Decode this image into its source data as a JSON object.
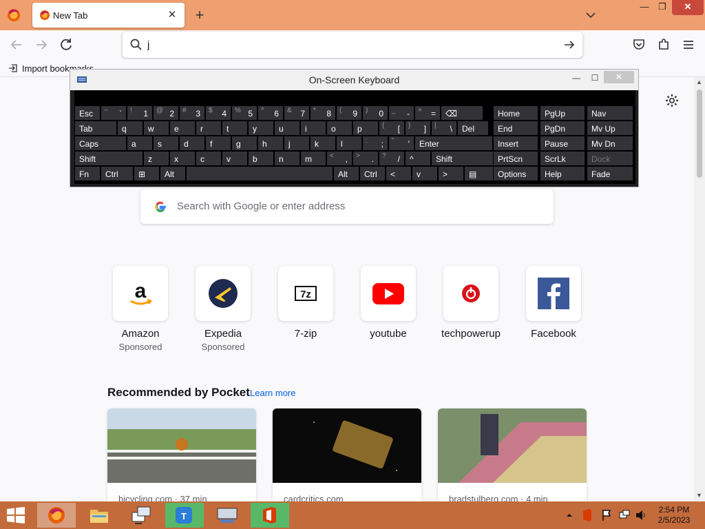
{
  "browser": {
    "tab_title": "New Tab",
    "close_tab_glyph": "✕",
    "new_tab_glyph": "+",
    "window_minimize_glyph": "—",
    "window_maximize_glyph": "❐",
    "window_close_glyph": "✕"
  },
  "urlbar": {
    "value": "j",
    "placeholder": ""
  },
  "bookmarks": [
    {
      "label": "Import bookmarks..."
    }
  ],
  "newtab": {
    "search_placeholder": "Search with Google or enter address",
    "top_sites": [
      {
        "name": "Amazon",
        "sponsored": "Sponsored",
        "icon": "amazon-icon"
      },
      {
        "name": "Expedia",
        "sponsored": "Sponsored",
        "icon": "expedia-icon"
      },
      {
        "name": "7-zip",
        "sponsored": "",
        "icon": "7zip-icon"
      },
      {
        "name": "youtube",
        "sponsored": "",
        "icon": "youtube-icon"
      },
      {
        "name": "techpowerup",
        "sponsored": "",
        "icon": "techpowerup-icon"
      },
      {
        "name": "Facebook",
        "sponsored": "",
        "icon": "facebook-icon"
      }
    ],
    "pocket_heading": "Recommended by Pocket",
    "pocket_learn_more": "Learn more",
    "pocket_cards": [
      {
        "source": "bicycling.com · 37 min"
      },
      {
        "source": "cardcritics.com"
      },
      {
        "source": "bradstulberg.com · 4 min"
      }
    ]
  },
  "osk": {
    "title": "On-Screen Keyboard",
    "rows": [
      [
        {
          "main": "Esc"
        },
        {
          "main": "`",
          "shift": "~"
        },
        {
          "main": "1",
          "shift": "!"
        },
        {
          "main": "2",
          "shift": "@"
        },
        {
          "main": "3",
          "shift": "#"
        },
        {
          "main": "4",
          "shift": "$"
        },
        {
          "main": "5",
          "shift": "%"
        },
        {
          "main": "6",
          "shift": "^"
        },
        {
          "main": "7",
          "shift": "&"
        },
        {
          "main": "8",
          "shift": "*"
        },
        {
          "main": "9",
          "shift": "("
        },
        {
          "main": "0",
          "shift": ")"
        },
        {
          "main": "-",
          "shift": "_"
        },
        {
          "main": "=",
          "shift": "+"
        },
        {
          "main": "⌫"
        }
      ],
      [
        {
          "main": "Tab"
        },
        {
          "main": "q"
        },
        {
          "main": "w"
        },
        {
          "main": "e"
        },
        {
          "main": "r"
        },
        {
          "main": "t"
        },
        {
          "main": "y"
        },
        {
          "main": "u"
        },
        {
          "main": "i"
        },
        {
          "main": "o"
        },
        {
          "main": "p"
        },
        {
          "main": "[",
          "shift": "{"
        },
        {
          "main": "]",
          "shift": "}"
        },
        {
          "main": "\\",
          "shift": "|"
        },
        {
          "main": "Del"
        }
      ],
      [
        {
          "main": "Caps"
        },
        {
          "main": "a"
        },
        {
          "main": "s"
        },
        {
          "main": "d"
        },
        {
          "main": "f"
        },
        {
          "main": "g"
        },
        {
          "main": "h"
        },
        {
          "main": "j"
        },
        {
          "main": "k"
        },
        {
          "main": "l"
        },
        {
          "main": ";",
          "shift": ":"
        },
        {
          "main": "'",
          "shift": "\""
        },
        {
          "main": "Enter"
        }
      ],
      [
        {
          "main": "Shift"
        },
        {
          "main": "z"
        },
        {
          "main": "x"
        },
        {
          "main": "c"
        },
        {
          "main": "v"
        },
        {
          "main": "b"
        },
        {
          "main": "n"
        },
        {
          "main": "m"
        },
        {
          "main": ",",
          "shift": "<"
        },
        {
          "main": ".",
          "shift": ">"
        },
        {
          "main": "/",
          "shift": "?"
        },
        {
          "main": "^"
        },
        {
          "main": "Shift"
        }
      ],
      [
        {
          "main": "Fn"
        },
        {
          "main": "Ctrl"
        },
        {
          "main": "⊞"
        },
        {
          "main": "Alt"
        },
        {
          "main": ""
        },
        {
          "main": "Alt"
        },
        {
          "main": "Ctrl"
        },
        {
          "main": "<"
        },
        {
          "main": "v"
        },
        {
          "main": ">"
        },
        {
          "main": "▤"
        }
      ]
    ],
    "nav_rows": [
      [
        {
          "main": "Home"
        },
        {
          "main": "PgUp"
        },
        {
          "main": "Nav"
        }
      ],
      [
        {
          "main": "End"
        },
        {
          "main": "PgDn"
        },
        {
          "main": "Mv Up"
        }
      ],
      [
        {
          "main": "Insert"
        },
        {
          "main": "Pause"
        },
        {
          "main": "Mv Dn"
        }
      ],
      [
        {
          "main": "PrtScn"
        },
        {
          "main": "ScrLk"
        },
        {
          "main": "Dock",
          "disabled": true
        }
      ],
      [
        {
          "main": "Options"
        },
        {
          "main": "Help"
        },
        {
          "main": "Fade"
        }
      ]
    ]
  },
  "taskbar": {
    "time": "2:54 PM",
    "date": "2/5/2023",
    "apps": [
      "start-icon",
      "firefox-icon",
      "file-explorer-icon",
      "network-icon",
      "teamviewer-icon",
      "on-screen-keyboard-icon",
      "office-icon"
    ]
  },
  "colors": {
    "titlebar": "#f0a070",
    "taskbar": "#c46b3c",
    "osk_key": "#333337",
    "link": "#0061e0"
  }
}
